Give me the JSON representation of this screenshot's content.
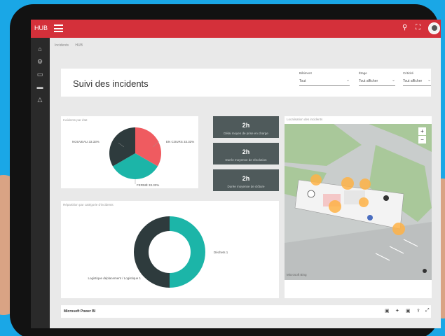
{
  "app": {
    "brand": "HUB"
  },
  "breadcrumb": [
    "Incidents",
    "HUB"
  ],
  "header": {
    "title": "Suivi des incidents",
    "filters": [
      {
        "label": "Bâtiment",
        "value": "Tout"
      },
      {
        "label": "Étage",
        "value": "Tout afficher"
      },
      {
        "label": "Criticité",
        "value": "Tout afficher"
      }
    ]
  },
  "pie_card": {
    "title": "Incidents par état",
    "labels": [
      "NOUVEAU 33.33%",
      "EN COURS 33.33%",
      "FERMÉ 33.33%"
    ],
    "colors": [
      "#ef5b60",
      "#1cb5a8",
      "#2e3b3d"
    ]
  },
  "tiles": [
    {
      "value": "2h",
      "label": "Délai moyen de prise en charge"
    },
    {
      "value": "2h",
      "label": "Durée moyenne de résolution"
    },
    {
      "value": "2h",
      "label": "Durée moyenne de clôture"
    }
  ],
  "donut_card": {
    "title": "Répartition par catégorie d'incidents",
    "labels": [
      "Déchets 1",
      "Logistique déplacement / Logistique 1"
    ],
    "colors": [
      "#1cb5a8",
      "#2e3b3d"
    ]
  },
  "map_card": {
    "title": "Localisation des incidents",
    "zoom_in": "+",
    "zoom_out": "−",
    "attribution": "Microsoft Bing"
  },
  "footer": {
    "label": "Microsoft Power BI"
  },
  "chart_data": [
    {
      "type": "pie",
      "title": "",
      "categories": [
        "NOUVEAU",
        "EN COURS",
        "FERMÉ"
      ],
      "values": [
        33.33,
        33.33,
        33.33
      ]
    },
    {
      "type": "pie",
      "title": "",
      "categories": [
        "Déchets",
        "Logistique déplacement / Logistique"
      ],
      "values": [
        1,
        1
      ]
    }
  ]
}
